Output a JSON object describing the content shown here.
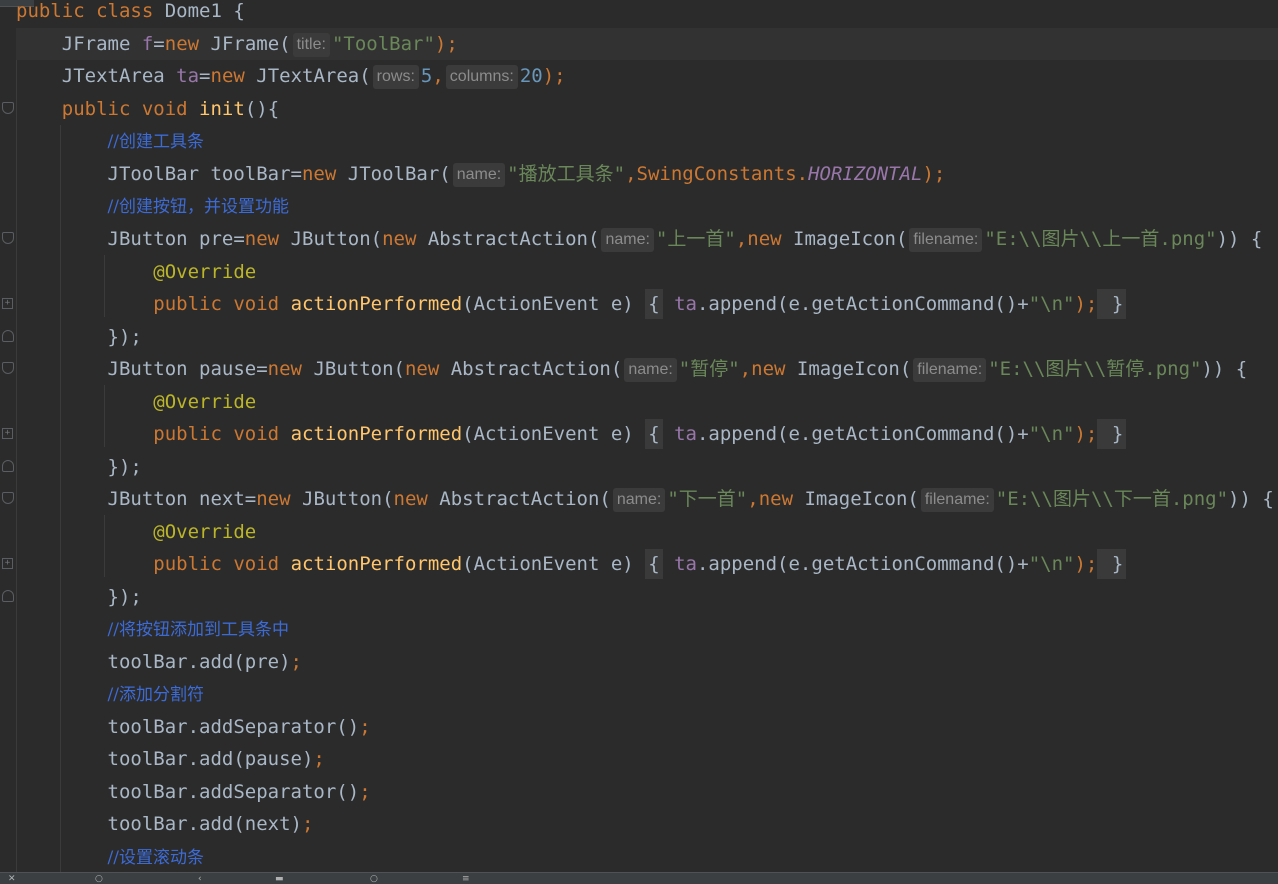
{
  "code": {
    "l0": {
      "a": "public class ",
      "b": "Dome1 {"
    },
    "l1": {
      "a": "JFrame ",
      "b": "f",
      "c": "=",
      "d": "new ",
      "e": "JFrame(",
      "hint": "title:",
      "f": "\"ToolBar\"",
      "g": ");"
    },
    "l2": {
      "a": "JTextArea ",
      "b": "ta",
      "c": "=",
      "d": "new ",
      "e": "JTextArea(",
      "hint1": "rows:",
      "n1": "5",
      "comma": ",",
      "hint2": "columns:",
      "n2": "20",
      "g": ");"
    },
    "l3": {
      "a": "public void ",
      "b": "init",
      "c": "(){"
    },
    "l4": {
      "comment": "//创建工具条"
    },
    "l5": {
      "a": "JToolBar toolBar=",
      "b": "new ",
      "c": "JToolBar(",
      "hint": "name:",
      "s": "\"播放工具条\"",
      "d": ",SwingConstants.",
      "e": "HORIZONTAL",
      "f": ");"
    },
    "l6": {
      "comment": "//创建按钮，并设置功能"
    },
    "l7": {
      "a": "JButton pre=",
      "b": "new ",
      "c": "JButton(",
      "d": "new ",
      "e": "AbstractAction(",
      "hint": "name:",
      "s": "\"上一首\"",
      "f": ",",
      "g": "new ",
      "h": "ImageIcon(",
      "hint2": "filename:",
      "s2": "\"E:\\\\图片\\\\上一首.png\"",
      "i": ")) {"
    },
    "l8": {
      "ann": "@Override"
    },
    "l9": {
      "a": "public void ",
      "b": "actionPerformed",
      "c": "(ActionEvent e) ",
      "brace1": "{",
      "d": " ",
      "e": "ta",
      "f": ".append(e.getActionCommand()+",
      "s": "\"\\n\"",
      "g": ");",
      "brace2": " }"
    },
    "l10": {
      "a": "});"
    },
    "l11": {
      "a": "JButton pause=",
      "b": "new ",
      "c": "JButton(",
      "d": "new ",
      "e": "AbstractAction(",
      "hint": "name:",
      "s": "\"暂停\"",
      "f": ",",
      "g": "new ",
      "h": "ImageIcon(",
      "hint2": "filename:",
      "s2": "\"E:\\\\图片\\\\暂停.png\"",
      "i": ")) {"
    },
    "l12": {
      "ann": "@Override"
    },
    "l13": {
      "a": "public void ",
      "b": "actionPerformed",
      "c": "(ActionEvent e) ",
      "brace1": "{",
      "d": " ",
      "e": "ta",
      "f": ".append(e.getActionCommand()+",
      "s": "\"\\n\"",
      "g": ");",
      "brace2": " }"
    },
    "l14": {
      "a": "});"
    },
    "l15": {
      "a": "JButton next=",
      "b": "new ",
      "c": "JButton(",
      "d": "new ",
      "e": "AbstractAction(",
      "hint": "name:",
      "s": "\"下一首\"",
      "f": ",",
      "g": "new ",
      "h": "ImageIcon(",
      "hint2": "filename:",
      "s2": "\"E:\\\\图片\\\\下一首.png\"",
      "i": ")) {"
    },
    "l16": {
      "ann": "@Override"
    },
    "l17": {
      "a": "public void ",
      "b": "actionPerformed",
      "c": "(ActionEvent e) ",
      "brace1": "{",
      "d": " ",
      "e": "ta",
      "f": ".append(e.getActionCommand()+",
      "s": "\"\\n\"",
      "g": ");",
      "brace2": " }"
    },
    "l18": {
      "a": "});"
    },
    "l19": {
      "comment": "//将按钮添加到工具条中"
    },
    "l20": {
      "a": "toolBar.add(pre)",
      "b": ";"
    },
    "l21": {
      "comment": "//添加分割符"
    },
    "l22": {
      "a": "toolBar.addSeparator()",
      "b": ";"
    },
    "l23": {
      "a": "toolBar.add(pause)",
      "b": ";"
    },
    "l24": {
      "a": "toolBar.addSeparator()",
      "b": ";"
    },
    "l25": {
      "a": "toolBar.add(next)",
      "b": ";"
    },
    "l26": {
      "comment": "//设置滚动条"
    }
  },
  "colors": {
    "background": "#2b2b2b",
    "keyword": "#cc7832",
    "string": "#6a8759",
    "number": "#6897bb",
    "comment": "#3d6bd6",
    "annotation": "#bbb529",
    "method": "#ffc66d",
    "field": "#9876aa"
  },
  "icons": [
    "fold-open-icon",
    "fold-close-icon",
    "fold-expand-icon"
  ]
}
